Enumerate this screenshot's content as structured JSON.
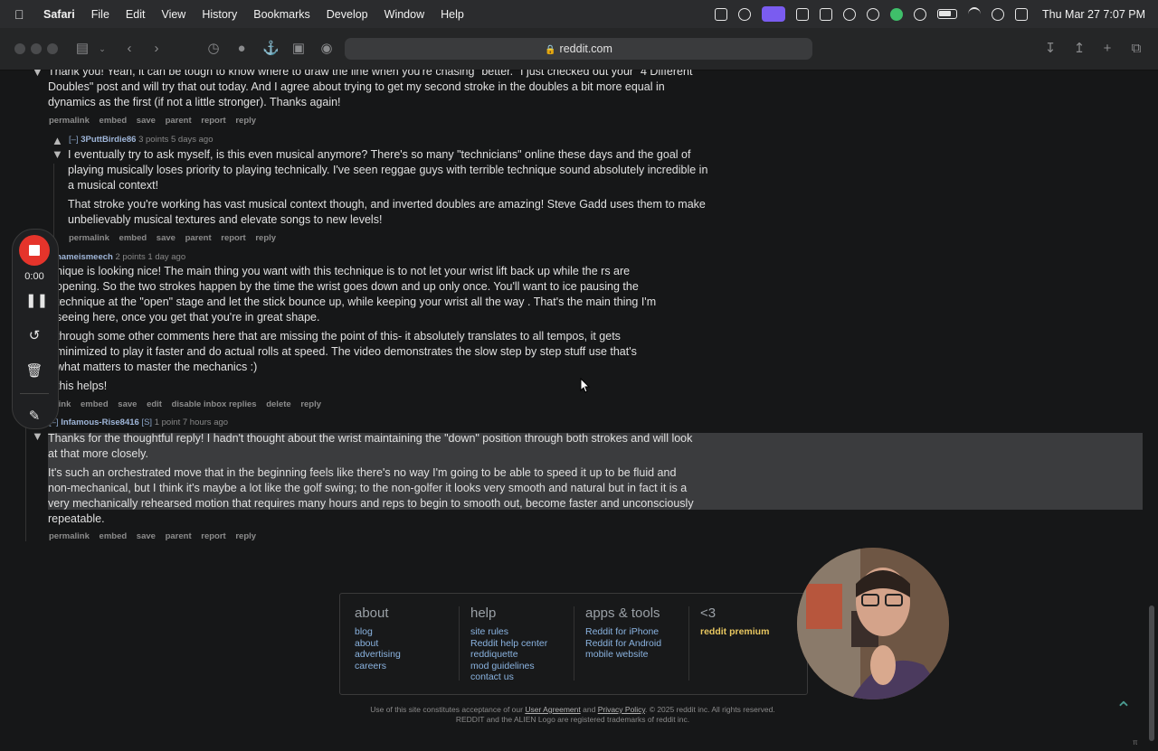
{
  "menubar": {
    "app": "Safari",
    "items": [
      "File",
      "Edit",
      "View",
      "History",
      "Bookmarks",
      "Develop",
      "Window",
      "Help"
    ],
    "clock": "Thu Mar 27  7:07 PM"
  },
  "browser": {
    "url": "reddit.com"
  },
  "comments": [
    {
      "tagline_user": "",
      "paragraphs": [
        "Thank you! Yeah, it can be tough to know where to draw the line when you're chasing \"better.\" I just checked out your \"4 Different Doubles\" post and will try that out today. And I agree about trying to get my second stroke in the doubles a bit more equal in dynamics as the first (if not a little stronger). Thanks again!"
      ],
      "buttons": [
        "permalink",
        "embed",
        "save",
        "parent",
        "report",
        "reply"
      ]
    },
    {
      "expand": "[–]",
      "user": "3PuttBirdie86",
      "meta": "3 points 5 days ago",
      "paragraphs": [
        "I eventually try to ask myself, is this even musical anymore? There's so many \"technicians\" online these days and the goal of playing musically loses priority to playing technically. I've seen reggae guys with terrible technique sound absolutely incredible in a musical context!",
        "That stroke you're working has vast musical context though, and inverted doubles are amazing! Steve Gadd uses them to make unbelievably musical textures and elevate songs to new levels!"
      ],
      "buttons": [
        "permalink",
        "embed",
        "save",
        "parent",
        "report",
        "reply"
      ]
    },
    {
      "user": "nameismeech",
      "meta": "2 points 1 day ago",
      "paragraphs": [
        "nique is looking nice! The main thing you want with this technique is to not let your wrist lift back up while the rs are opening. So the two strokes happen by the time the wrist goes down and up only once. You'll want to ice pausing the technique at the \"open\" stage and let the stick bounce up, while keeping your wrist all the way . That's the main thing I'm seeing here, once you get that you're in great shape.",
        "through some other comments here that are missing the point of this- it absolutely translates to all tempos, it gets minimized to play it faster and do actual rolls at speed. The video demonstrates the slow step by step stuff use that's what matters to master the mechanics :)",
        "this helps!"
      ],
      "buttons": [
        "link",
        "embed",
        "save",
        "edit",
        "disable inbox replies",
        "delete",
        "reply"
      ]
    },
    {
      "expand": "[–]",
      "user": "Infamous-Rise8416",
      "flair": "[S]",
      "meta": "1 point 7 hours ago",
      "paragraphs": [
        "Thanks for the thoughtful reply! I hadn't thought about the wrist maintaining the \"down\" position through both strokes and will look at that more closely.",
        "It's such an orchestrated move that in the beginning feels like there's no way I'm going to be able to speed it up to be fluid and non-mechanical, but I think it's maybe a lot like the golf swing; to the non-golfer it looks very smooth and natural but in fact it is a very mechanically rehearsed motion that requires many hours and reps to begin to smooth out, become faster and unconsciously repeatable."
      ],
      "buttons": [
        "permalink",
        "embed",
        "save",
        "parent",
        "report",
        "reply"
      ]
    }
  ],
  "footer": {
    "columns": [
      {
        "heading": "about",
        "links": [
          "blog",
          "about",
          "advertising",
          "careers"
        ]
      },
      {
        "heading": "help",
        "links": [
          "site rules",
          "Reddit help center",
          "reddiquette",
          "mod guidelines",
          "contact us"
        ]
      },
      {
        "heading": "apps & tools",
        "links": [
          "Reddit for iPhone",
          "Reddit for Android",
          "mobile website"
        ]
      },
      {
        "heading": "<3",
        "links": [
          "reddit premium"
        ]
      }
    ],
    "legal_line1_prefix": "Use of this site constitutes acceptance of our",
    "legal_user_agreement": "User Agreement",
    "legal_and": "and",
    "legal_privacy": "Privacy Policy",
    "legal_line1_suffix": ". © 2025 reddit inc. All rights reserved.",
    "legal_line2": "REDDIT and the ALIEN Logo are registered trademarks of reddit inc."
  },
  "recorder": {
    "time": "0:00"
  },
  "footer_extra": {
    "pi": "π"
  }
}
